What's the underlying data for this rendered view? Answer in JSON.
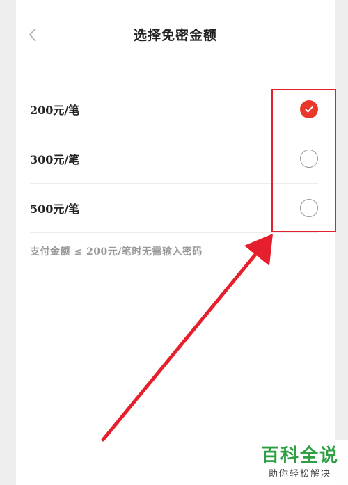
{
  "header": {
    "title": "选择免密金额",
    "back_icon": "chevron-left-icon"
  },
  "options": [
    {
      "label": "200元/笔",
      "selected": true
    },
    {
      "label": "300元/笔",
      "selected": false
    },
    {
      "label": "500元/笔",
      "selected": false
    }
  ],
  "hint": "支付金额 ≤ 200元/笔时无需输入密码",
  "colors": {
    "accent": "#e8382b",
    "annotation": "#e5202c",
    "watermark": "#2ea043"
  },
  "watermark": {
    "main": "百科全说",
    "sub": "助你轻松解决"
  }
}
